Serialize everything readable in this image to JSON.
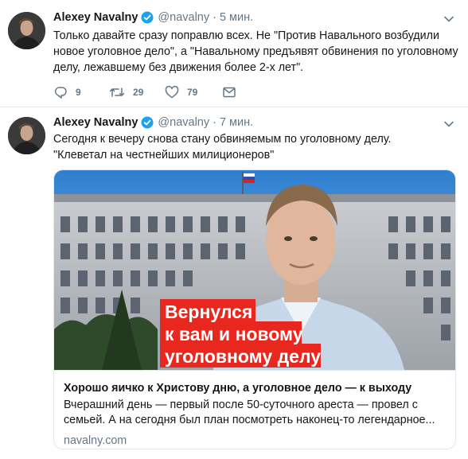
{
  "tweets": [
    {
      "author": {
        "name": "Alexey Navalny",
        "handle": "@navalny"
      },
      "separator": "·",
      "time": "5 мин.",
      "text_lines": [
        "Только давайте сразу поправлю всех. Не \"Против Навального возбудили",
        "новое уголовное дело\", а \"Навальному предъявят обвинения по уголовному",
        "делу, лежавшему без движения более 2-х лет\"."
      ],
      "actions": {
        "replies": "9",
        "retweets": "29",
        "likes": "79"
      }
    },
    {
      "author": {
        "name": "Alexey Navalny",
        "handle": "@navalny"
      },
      "separator": "·",
      "time": "7 мин.",
      "text_lines": [
        "Сегодня к вечеру снова стану обвиняемым по уголовному делу.",
        "\"Клеветал на честнейших милиционеров\""
      ],
      "card": {
        "image_caption_lines": [
          "Вернулся",
          "к вам и новому",
          "уголовному делу"
        ],
        "title": "Хорошо яичко к Христову дню, а уголовное дело — к выходу",
        "description_lines": [
          "Вчерашний день — первый после 50-суточного ареста — провел с",
          "семьей. А на сегодня был план посмотреть наконец-то легендарное..."
        ],
        "domain": "navalny.com"
      }
    }
  ],
  "colors": {
    "text": "#14171a",
    "secondary": "#657786",
    "verified": "#1da1f2",
    "border": "#e6ecf0",
    "caption_bg": "#e8281e"
  },
  "icons": [
    "verified-badge-icon",
    "chevron-down-icon",
    "reply-icon",
    "retweet-icon",
    "like-icon",
    "direct-message-icon"
  ]
}
